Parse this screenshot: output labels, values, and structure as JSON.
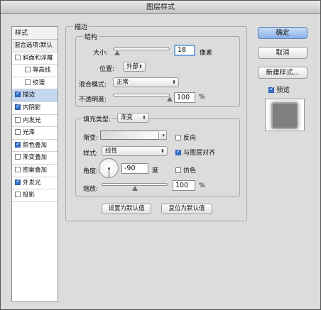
{
  "window": {
    "title": "图层样式"
  },
  "styles_panel": {
    "header": "样式",
    "blending_options": "混合选项:默认",
    "items": [
      {
        "label": "斜面和浮雕",
        "checked": false,
        "indent": false,
        "selected": false
      },
      {
        "label": "等高线",
        "checked": false,
        "indent": true,
        "selected": false
      },
      {
        "label": "纹理",
        "checked": false,
        "indent": true,
        "selected": false
      },
      {
        "label": "描边",
        "checked": true,
        "indent": false,
        "selected": true
      },
      {
        "label": "内阴影",
        "checked": true,
        "indent": false,
        "selected": false
      },
      {
        "label": "内发光",
        "checked": false,
        "indent": false,
        "selected": false
      },
      {
        "label": "光泽",
        "checked": false,
        "indent": false,
        "selected": false
      },
      {
        "label": "颜色叠加",
        "checked": true,
        "indent": false,
        "selected": false
      },
      {
        "label": "渐变叠加",
        "checked": false,
        "indent": false,
        "selected": false
      },
      {
        "label": "图案叠加",
        "checked": false,
        "indent": false,
        "selected": false
      },
      {
        "label": "外发光",
        "checked": true,
        "indent": false,
        "selected": false
      },
      {
        "label": "投影",
        "checked": false,
        "indent": false,
        "selected": false
      }
    ]
  },
  "stroke": {
    "section_title": "描边",
    "structure_title": "结构",
    "size_label": "大小:",
    "size_value": "18",
    "size_unit": "像素",
    "size_slider_value": 0.08,
    "position_label": "位置:",
    "position_value": "外部",
    "blend_label": "混合模式:",
    "blend_value": "正常",
    "opacity_label": "不透明度:",
    "opacity_value": "100",
    "opacity_unit": "%",
    "opacity_slider_value": 1.0
  },
  "fill": {
    "type_label": "填充类型:",
    "type_value": "渐变",
    "gradient_label": "渐变:",
    "reverse_label": "反向",
    "reverse_checked": false,
    "style_label": "样式:",
    "style_value": "线性",
    "align_label": "与图层对齐",
    "align_checked": true,
    "angle_label": "角度:",
    "angle_value": "-90",
    "angle_unit": "度",
    "dither_label": "仿色",
    "dither_checked": false,
    "scale_label": "缩放:",
    "scale_value": "100",
    "scale_unit": "%",
    "scale_slider_value": 0.5
  },
  "bottom_buttons": {
    "set_default": "设置为默认值",
    "reset_default": "复位为默认值"
  },
  "side_buttons": {
    "ok": "确定",
    "cancel": "取消",
    "new_style": "新建样式...",
    "preview_label": "预览",
    "preview_checked": true
  },
  "colors": {
    "selected_row": "#c5d7ee",
    "checkbox_on": "#2f6fd0",
    "primary_button": "#8ab1e6"
  }
}
